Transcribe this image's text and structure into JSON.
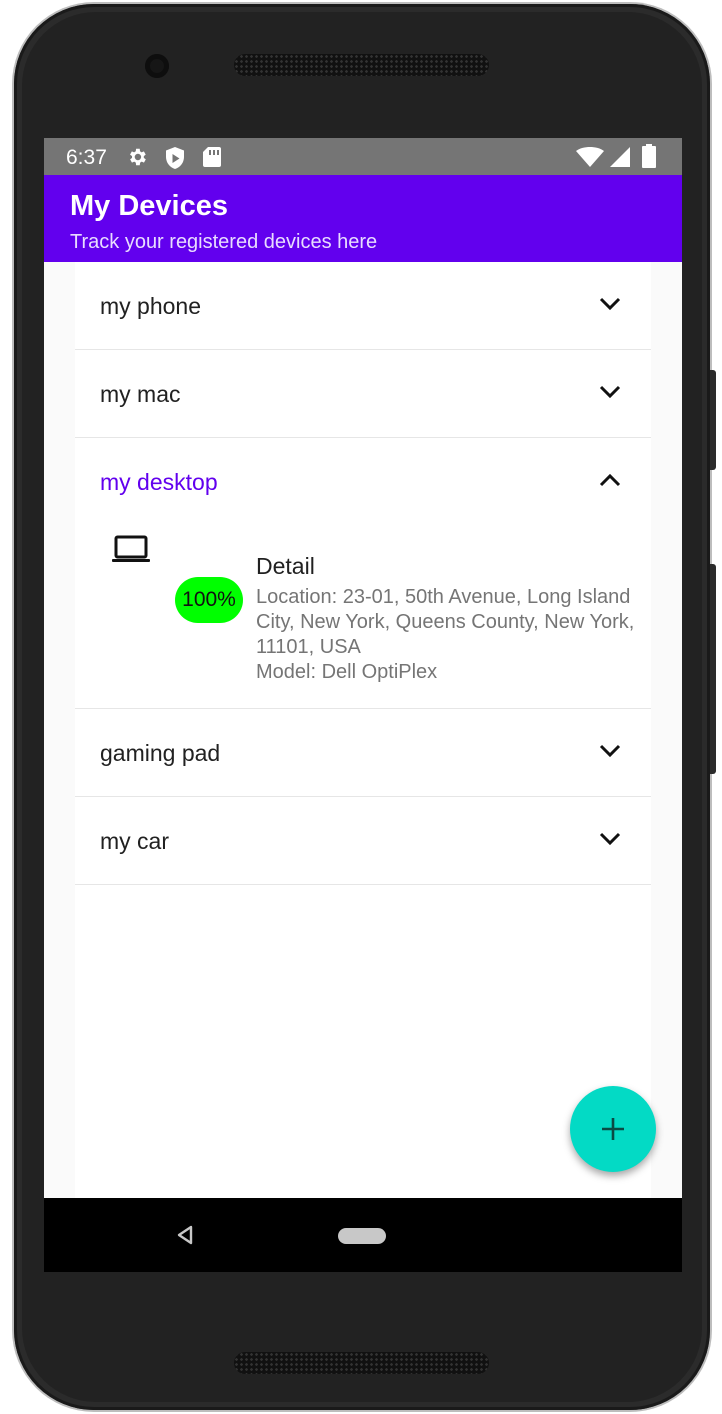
{
  "status_bar": {
    "time": "6:37",
    "icons_left": [
      "gear-icon",
      "shield-icon",
      "sd-card-icon"
    ],
    "icons_right": [
      "wifi-icon",
      "signal-icon",
      "battery-icon"
    ]
  },
  "app_bar": {
    "title": "My Devices",
    "subtitle": "Track your registered devices here",
    "color": "#6200ee"
  },
  "devices": [
    {
      "label": "my phone",
      "expanded": false
    },
    {
      "label": "my mac",
      "expanded": false
    },
    {
      "label": "my desktop",
      "expanded": true,
      "detail": {
        "battery": "100%",
        "title": "Detail",
        "location": "Location: 23-01, 50th Avenue, Long Island City, New York, Queens County, New York, 11101, USA",
        "model": "Model: Dell OptiPlex"
      }
    },
    {
      "label": "gaming pad",
      "expanded": false
    },
    {
      "label": "my car",
      "expanded": false
    }
  ],
  "fab": {
    "icon": "plus-icon",
    "color": "#03dac5"
  },
  "nav_bar": {
    "icons": [
      "back-icon",
      "home-pill"
    ]
  },
  "colors": {
    "accent": "#6200ee",
    "battery_full": "#00ff00"
  }
}
